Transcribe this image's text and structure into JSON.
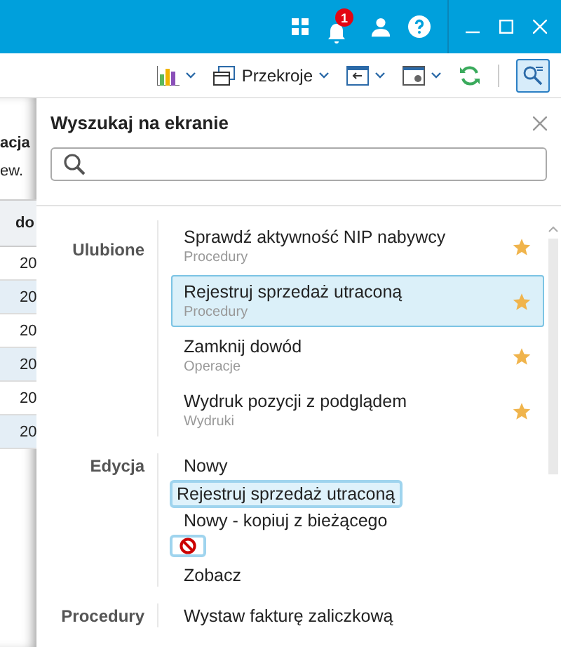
{
  "topbar": {
    "notifications": "1"
  },
  "toolbar": {
    "sections_button": "Przekroje"
  },
  "background_table": {
    "header_1": "acja",
    "header_2": "ew.",
    "column_1": "do",
    "rows": [
      {
        "cell": "20",
        "selected": false
      },
      {
        "cell": "20",
        "selected": true
      },
      {
        "cell": "20",
        "selected": false
      },
      {
        "cell": "20",
        "selected": true
      },
      {
        "cell": "20",
        "selected": false
      },
      {
        "cell": "20",
        "selected": true
      }
    ]
  },
  "panel": {
    "title": "Wyszukaj na ekranie",
    "groups": [
      {
        "label": "Ulubione",
        "items": [
          {
            "title": "Sprawdź aktywność NIP nabywcy",
            "category": "Procedury",
            "favorite": true,
            "selected": false
          },
          {
            "title": "Rejestruj sprzedaż utraconą",
            "category": "Procedury",
            "favorite": true,
            "selected": true
          },
          {
            "title": "Zamknij dowód",
            "category": "Operacje",
            "favorite": true,
            "selected": false
          },
          {
            "title": "Wydruk pozycji z podglądem",
            "category": "Wydruki",
            "favorite": true,
            "selected": false
          }
        ]
      },
      {
        "label": "Edycja",
        "items": [
          {
            "title": "Nowy",
            "favorite": false,
            "selected": false
          },
          {
            "title": "Nowy - kopiuj z bieżącego",
            "favorite": false,
            "selected": false
          },
          {
            "title": "Zobacz",
            "favorite": false,
            "selected": false
          }
        ]
      },
      {
        "label": "Procedury",
        "items": [
          {
            "title": "Wystaw fakturę zaliczkową",
            "favorite": false,
            "selected": false
          }
        ]
      }
    ]
  },
  "drag_ghost": {
    "label": "Rejestruj sprzedaż utraconą"
  }
}
